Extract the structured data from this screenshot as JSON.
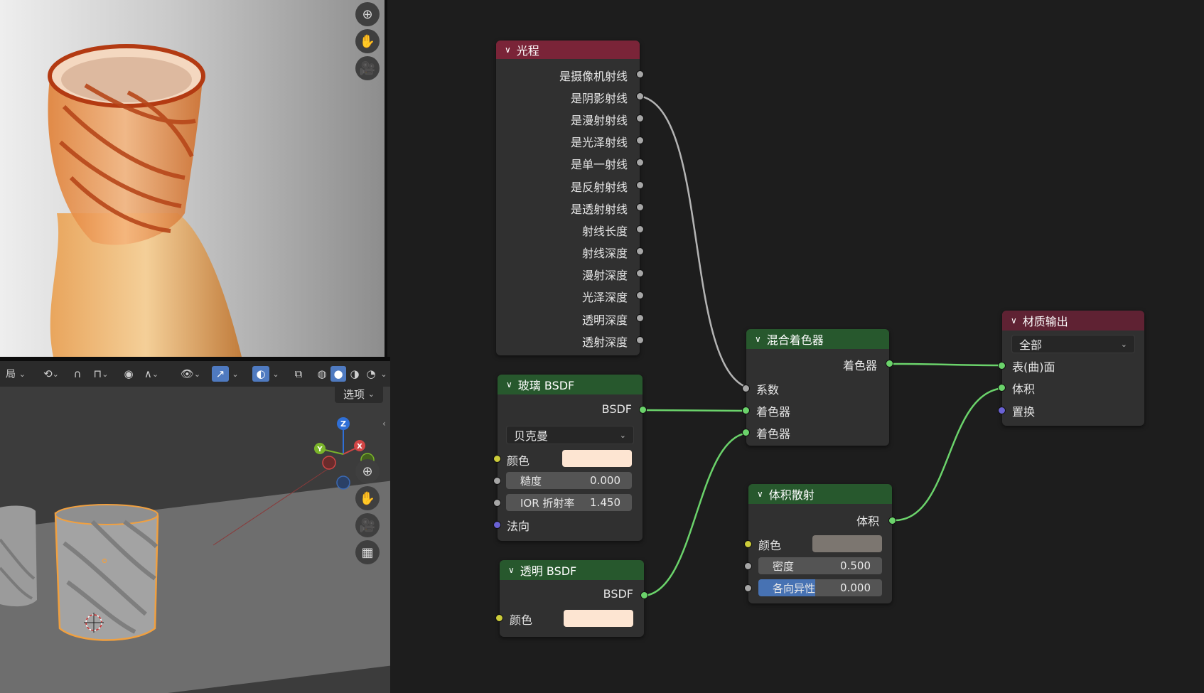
{
  "viewport_header": {
    "options_label": "选项",
    "truncated_left_label": "局"
  },
  "nav_gizmo": {
    "z_label": "Z",
    "y_label": "Y",
    "x_label": "X"
  },
  "nodes": {
    "light_path": {
      "title": "光程",
      "outputs": [
        "是摄像机射线",
        "是阴影射线",
        "是漫射射线",
        "是光泽射线",
        "是单一射线",
        "是反射射线",
        "是透射射线",
        "射线长度",
        "射线深度",
        "漫射深度",
        "光泽深度",
        "透明深度",
        "透射深度"
      ]
    },
    "glass": {
      "title": "玻璃 BSDF",
      "output": "BSDF",
      "distribution": "贝克曼",
      "color_label": "颜色",
      "color_value": "#fde5d2",
      "roughness_label": "糙度",
      "roughness_value": "0.000",
      "ior_label": "IOR 折射率",
      "ior_value": "1.450",
      "normal_label": "法向"
    },
    "transparent": {
      "title": "透明 BSDF",
      "output": "BSDF",
      "color_label": "颜色",
      "color_value": "#fde5d2"
    },
    "mix": {
      "title": "混合着色器",
      "output": "着色器",
      "fac_label": "系数",
      "shader1_label": "着色器",
      "shader2_label": "着色器"
    },
    "volume": {
      "title": "体积散射",
      "output": "体积",
      "color_label": "颜色",
      "color_value": "#7c7670",
      "density_label": "密度",
      "density_value": "0.500",
      "anisotropy_label": "各向异性",
      "anisotropy_value": "0.000"
    },
    "output": {
      "title": "材质输出",
      "target": "全部",
      "surface_label": "表(曲)面",
      "volume_label": "体积",
      "displacement_label": "置换"
    }
  },
  "colors": {
    "header_light_path": "#7a2438",
    "header_shader": "#27582d",
    "header_output": "#5f2233",
    "socket_shader": "#6bd36b",
    "socket_float": "#a6a6a6",
    "socket_color": "#cccc3a",
    "socket_vector": "#6a62d4",
    "selection_outline": "#f0a040"
  }
}
